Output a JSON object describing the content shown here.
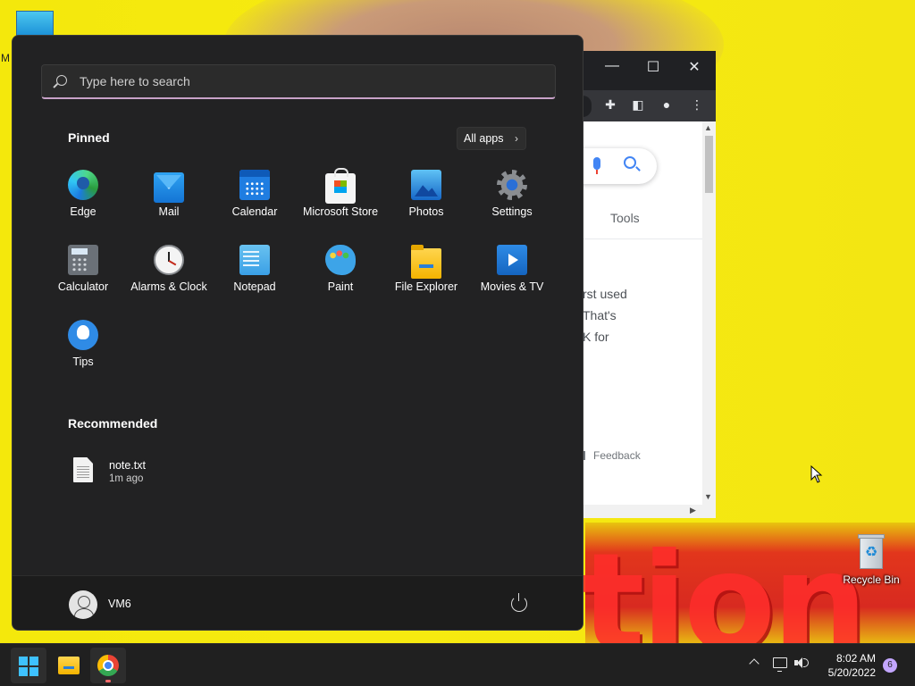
{
  "desktop": {
    "wallpaper_text": "tion",
    "top_left_label": "M",
    "recycle_bin_label": "Recycle Bin"
  },
  "browser": {
    "tools_label": "Tools",
    "snippet_lines": [
      "rst used",
      "That's",
      "K for"
    ],
    "feedback_label": "Feedback"
  },
  "start_menu": {
    "search": {
      "placeholder": "Type here to search",
      "value": ""
    },
    "pinned_title": "Pinned",
    "all_apps_label": "All apps",
    "pinned_apps": [
      {
        "label": "Edge",
        "icon": "edge-icon"
      },
      {
        "label": "Mail",
        "icon": "mail-icon"
      },
      {
        "label": "Calendar",
        "icon": "calendar-icon"
      },
      {
        "label": "Microsoft Store",
        "icon": "microsoft-store-icon"
      },
      {
        "label": "Photos",
        "icon": "photos-icon"
      },
      {
        "label": "Settings",
        "icon": "settings-icon"
      },
      {
        "label": "Calculator",
        "icon": "calculator-icon"
      },
      {
        "label": "Alarms & Clock",
        "icon": "alarms-clock-icon"
      },
      {
        "label": "Notepad",
        "icon": "notepad-icon"
      },
      {
        "label": "Paint",
        "icon": "paint-icon"
      },
      {
        "label": "File Explorer",
        "icon": "file-explorer-icon"
      },
      {
        "label": "Movies & TV",
        "icon": "movies-tv-icon"
      },
      {
        "label": "Tips",
        "icon": "tips-icon"
      }
    ],
    "recommended_title": "Recommended",
    "recommended": [
      {
        "name": "note.txt",
        "time": "1m ago",
        "icon": "text-file-icon"
      }
    ],
    "user": {
      "name": "VM6"
    }
  },
  "taskbar": {
    "clock_time": "8:02 AM",
    "clock_date": "5/20/2022",
    "notification_count": "6"
  },
  "colors": {
    "start_bg": "#222223",
    "search_accent": "#c8a2c8",
    "taskbar_bg": "#202020",
    "wallpaper": "#f4e80c"
  }
}
